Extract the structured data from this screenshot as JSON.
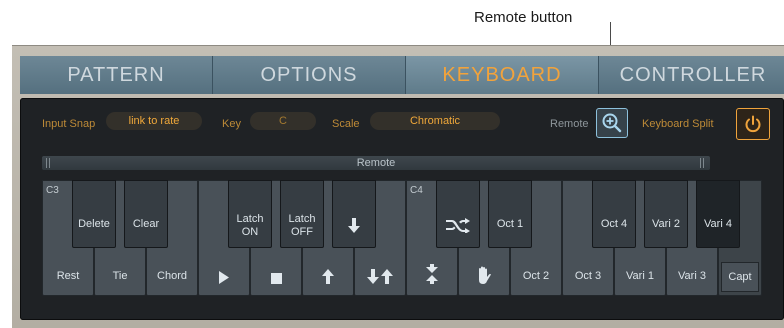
{
  "callout": {
    "label": "Remote button"
  },
  "tabs": [
    {
      "label": "PATTERN",
      "active": false
    },
    {
      "label": "OPTIONS",
      "active": false
    },
    {
      "label": "KEYBOARD",
      "active": true
    },
    {
      "label": "CONTROLLER",
      "active": false
    }
  ],
  "controls": {
    "input_snap_label": "Input Snap",
    "input_snap_value": "link to rate",
    "key_label": "Key",
    "key_value": "C",
    "scale_label": "Scale",
    "scale_value": "Chromatic",
    "remote_label": "Remote",
    "remote_icon": "zoom-in-icon",
    "keyboard_split_label": "Keyboard Split",
    "keyboard_split_icon": "power-icon"
  },
  "remote_bar": {
    "label": "Remote"
  },
  "keys": {
    "c3_note": "C3",
    "c4_note": "C4",
    "rest": "Rest",
    "tie": "Tie",
    "chord": "Chord",
    "delete": "Delete",
    "clear": "Clear",
    "latch_on": "Latch ON",
    "latch_off": "Latch OFF",
    "oct1": "Oct 1",
    "oct2": "Oct 2",
    "oct3": "Oct 3",
    "oct4": "Oct 4",
    "vari1": "Vari 1",
    "vari2": "Vari 2",
    "vari3": "Vari 3",
    "vari4": "Vari 4",
    "capt": "Capt"
  },
  "colors": {
    "accent_orange": "#f0a33b",
    "remote_blue": "#8dc1dc",
    "panel_bg": "#1f2225"
  }
}
